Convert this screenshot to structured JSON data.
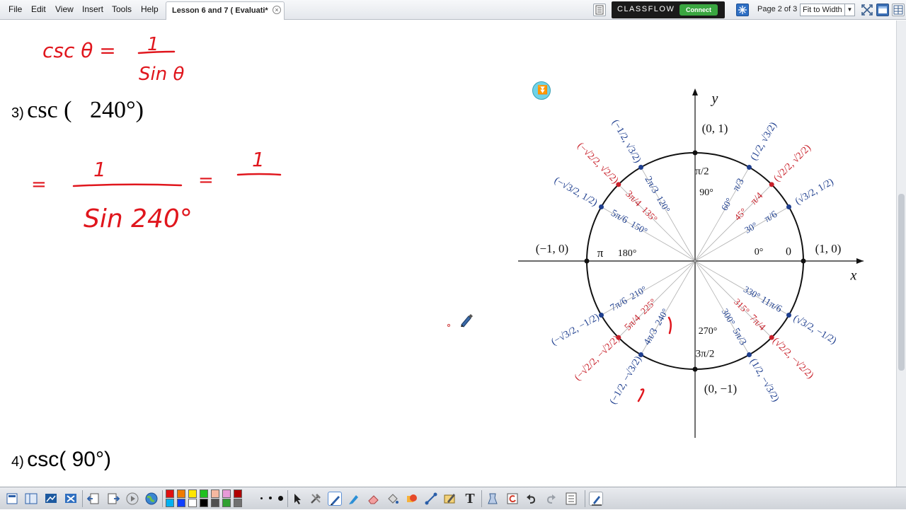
{
  "menu": {
    "items": [
      "File",
      "Edit",
      "View",
      "Insert",
      "Tools",
      "Help"
    ]
  },
  "tab": {
    "title": "Lesson 6 and 7 ( Evaluati*",
    "close_glyph": "×"
  },
  "classflow": {
    "brand": "CLASSFLOW",
    "connect_label": "Connect"
  },
  "navigation": {
    "page_indicator": "Page 2 of 3",
    "zoom_value": "Fit to Width"
  },
  "flipchart": {
    "problem3": {
      "number": "3)",
      "expression": "csc (   240°)"
    },
    "problem4": {
      "number": "4)",
      "expression": "csc( 90°)"
    },
    "handwriting": {
      "identity_left": "csc θ =",
      "identity_num": "1",
      "identity_den": "Sin θ",
      "step_eq1": "=",
      "step_num": "1",
      "step_den": "Sin 240°",
      "step_eq2": "=",
      "step_num2": "1"
    },
    "ink_color": "#e0161d"
  },
  "unit_circle": {
    "axis_x": "x",
    "axis_y": "y",
    "colors": {
      "blue": "#1f3f8f",
      "red": "#c8202a",
      "black": "#111111"
    },
    "axis_points": {
      "right": "(1, 0)",
      "top": "(0, 1)",
      "left": "(−1, 0)",
      "bottom": "(0, −1)"
    },
    "angles": [
      {
        "deg": "0°",
        "rad": "0",
        "color": "black"
      },
      {
        "deg": "30°",
        "rad": "π/6",
        "color": "blue",
        "coord": "(√3/2, 1/2)"
      },
      {
        "deg": "45°",
        "rad": "π/4",
        "color": "red",
        "coord": "(√2/2, √2/2)"
      },
      {
        "deg": "60°",
        "rad": "π/3",
        "color": "blue",
        "coord": "(1/2, √3/2)"
      },
      {
        "deg": "90°",
        "rad": "π/2",
        "color": "black"
      },
      {
        "deg": "120°",
        "rad": "2π/3",
        "color": "blue",
        "coord": "(−1/2, √3/2)"
      },
      {
        "deg": "135°",
        "rad": "3π/4",
        "color": "red",
        "coord": "(−√2/2, √2/2)"
      },
      {
        "deg": "150°",
        "rad": "5π/6",
        "color": "blue",
        "coord": "(−√3/2, 1/2)"
      },
      {
        "deg": "180°",
        "rad": "π",
        "color": "black"
      },
      {
        "deg": "210°",
        "rad": "7π/6",
        "color": "blue",
        "coord": "(−√3/2, −1/2)"
      },
      {
        "deg": "225°",
        "rad": "5π/4",
        "color": "red",
        "coord": "(−√2/2, −√2/2)"
      },
      {
        "deg": "240°",
        "rad": "4π/3",
        "color": "blue",
        "coord": "(−1/2, −√3/2)"
      },
      {
        "deg": "270°",
        "rad": "3π/2",
        "color": "black"
      },
      {
        "deg": "300°",
        "rad": "5π/3",
        "color": "blue",
        "coord": "(1/2, −√3/2)"
      },
      {
        "deg": "315°",
        "rad": "7π/4",
        "color": "red",
        "coord": "(√2/2, −√2/2)"
      },
      {
        "deg": "330°",
        "rad": "11π/6",
        "color": "blue",
        "coord": "(√3/2, −1/2)"
      }
    ]
  },
  "toolbar": {
    "palette": [
      "#e01010",
      "#f07a00",
      "#ffe600",
      "#20c020",
      "#f5b8a0",
      "#e89ad8",
      "#b00000",
      "#00b0f0",
      "#1040ff",
      "#ffffff",
      "#000000",
      "#505050",
      "#30a030",
      "#707070"
    ],
    "text_tool_glyph": "T"
  }
}
